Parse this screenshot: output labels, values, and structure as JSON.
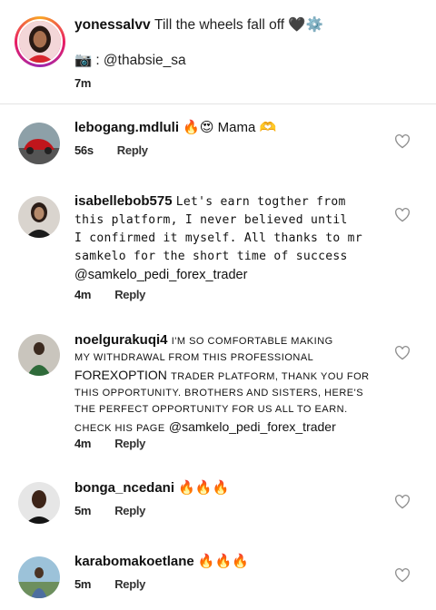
{
  "post": {
    "username": "yonessalvv",
    "caption": "Till the wheels fall off 🖤⚙️",
    "credit_icon": "📷",
    "credit": ": @thabsie_sa",
    "time": "7m"
  },
  "comments": [
    {
      "username": "lebogang.mdluli",
      "text": "🔥😍 Mama 🫶",
      "time": "56s",
      "reply": "Reply"
    },
    {
      "username": "isabellebob575",
      "text_lines": [
        "Let's earn togther from",
        "this platform, I never believed until",
        "I confirmed it myself. All thanks to mr",
        "samkelo for the short time of success"
      ],
      "mention": "@samkelo_pedi_forex_trader",
      "time": "4m",
      "reply": "Reply"
    },
    {
      "username": "noelgurakuqi4",
      "line1": "I'm so comfortable making",
      "line2": "my withdrawal from this professional",
      "line3_a": "FOREXOPTION",
      "line3_b": "trader platform, thank you for",
      "line4": "this opportunity. Brothers and sisters, here's",
      "line5": "the perfect opportunity for us all to earn.",
      "line6_a": "Check his page",
      "line6_b": "@samkelo_pedi_forex_trader",
      "time": "4m",
      "reply": "Reply"
    },
    {
      "username": "bonga_ncedani",
      "text": "🔥🔥🔥",
      "time": "5m",
      "reply": "Reply"
    },
    {
      "username": "karabomakoetlane",
      "text": "🔥🔥🔥",
      "time": "5m",
      "reply": "Reply"
    }
  ],
  "icons": {
    "like": "heart-outline-icon"
  }
}
